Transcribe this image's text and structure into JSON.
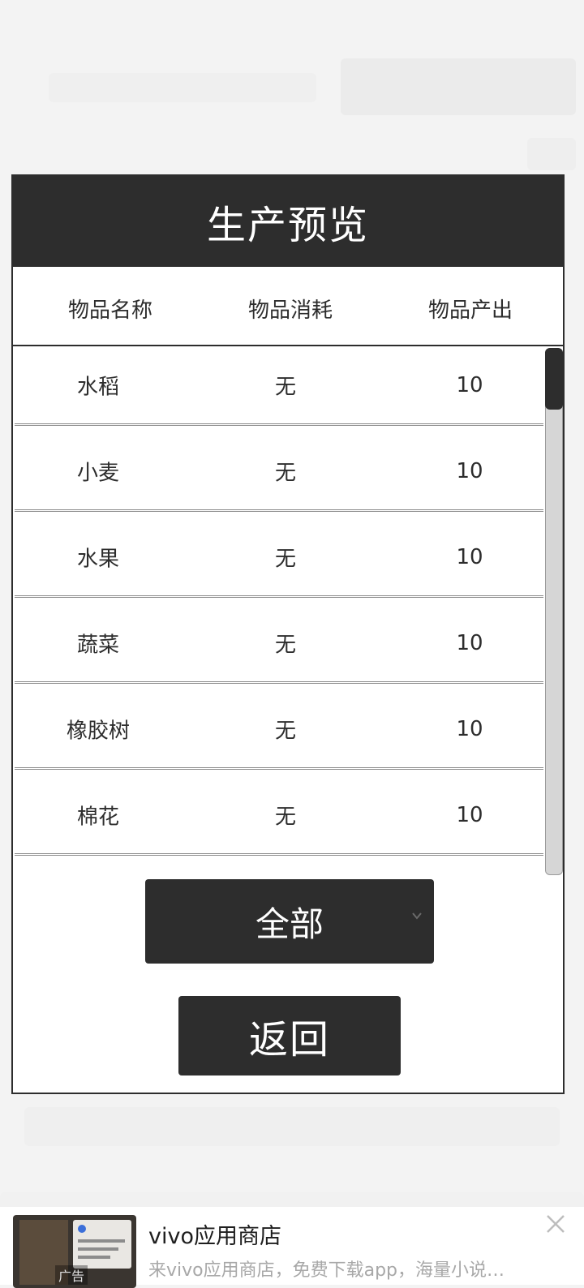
{
  "dialog": {
    "title": "生产预览",
    "columns": {
      "name": "物品名称",
      "consume": "物品消耗",
      "output": "物品产出"
    },
    "rows": [
      {
        "name": "水稻",
        "consume": "无",
        "output": "10"
      },
      {
        "name": "小麦",
        "consume": "无",
        "output": "10"
      },
      {
        "name": "水果",
        "consume": "无",
        "output": "10"
      },
      {
        "name": "蔬菜",
        "consume": "无",
        "output": "10"
      },
      {
        "name": "橡胶树",
        "consume": "无",
        "output": "10"
      },
      {
        "name": "棉花",
        "consume": "无",
        "output": "10"
      }
    ],
    "filter_select": {
      "value": "全部",
      "icon": "chevron-down-icon"
    },
    "back_button": "返回"
  },
  "ad": {
    "title": "vivo应用商店",
    "description": "来vivo应用商店，免费下载app，海量小说…",
    "tag": "广告",
    "close_icon": "close-icon"
  },
  "colors": {
    "dark": "#2d2d2d",
    "panel": "#ffffff",
    "scroll_track": "#d6d6d6"
  }
}
